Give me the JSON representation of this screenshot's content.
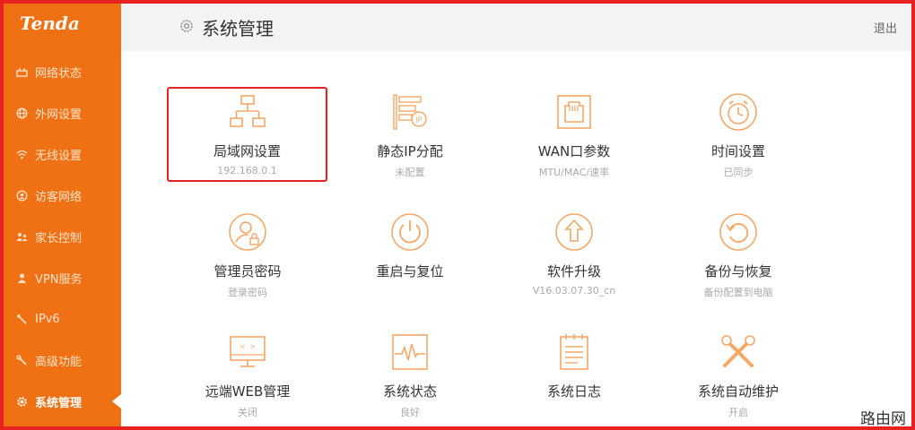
{
  "app": {
    "logo": "Tenda"
  },
  "header": {
    "title": "系统管理",
    "logout": "退出"
  },
  "sidebar": {
    "items": [
      {
        "label": "网络状态",
        "icon": "network-status-icon"
      },
      {
        "label": "外网设置",
        "icon": "globe-icon"
      },
      {
        "label": "无线设置",
        "icon": "wifi-icon"
      },
      {
        "label": "访客网络",
        "icon": "guest-icon"
      },
      {
        "label": "家长控制",
        "icon": "parental-icon"
      },
      {
        "label": "VPN服务",
        "icon": "vpn-icon"
      },
      {
        "label": "IPv6",
        "icon": "ipv6-icon"
      },
      {
        "label": "高级功能",
        "icon": "wrench-icon"
      },
      {
        "label": "系统管理",
        "icon": "gear-icon",
        "active": true
      }
    ]
  },
  "tiles": [
    {
      "name": "局域网设置",
      "sub": "192.168.0.1",
      "icon": "lan-icon"
    },
    {
      "name": "静态IP分配",
      "sub": "未配置",
      "icon": "static-ip-icon"
    },
    {
      "name": "WAN口参数",
      "sub": "MTU/MAC/速率",
      "icon": "wan-port-icon"
    },
    {
      "name": "时间设置",
      "sub": "已同步",
      "icon": "clock-icon"
    },
    {
      "name": "管理员密码",
      "sub": "登录密码",
      "icon": "admin-password-icon"
    },
    {
      "name": "重启与复位",
      "sub": "",
      "icon": "power-icon"
    },
    {
      "name": "软件升级",
      "sub": "V16.03.07.30_cn",
      "icon": "upgrade-icon"
    },
    {
      "name": "备份与恢复",
      "sub": "备份配置到电脑",
      "icon": "backup-icon"
    },
    {
      "name": "远端WEB管理",
      "sub": "关闭",
      "icon": "remote-web-icon"
    },
    {
      "name": "系统状态",
      "sub": "良好",
      "icon": "system-status-icon"
    },
    {
      "name": "系统日志",
      "sub": "",
      "icon": "log-icon"
    },
    {
      "name": "系统自动维护",
      "sub": "开启",
      "icon": "maintenance-icon"
    }
  ],
  "watermark": "路由网",
  "colors": {
    "accent": "#f07114",
    "icon": "#f5a766",
    "highlight": "#e8231f"
  }
}
